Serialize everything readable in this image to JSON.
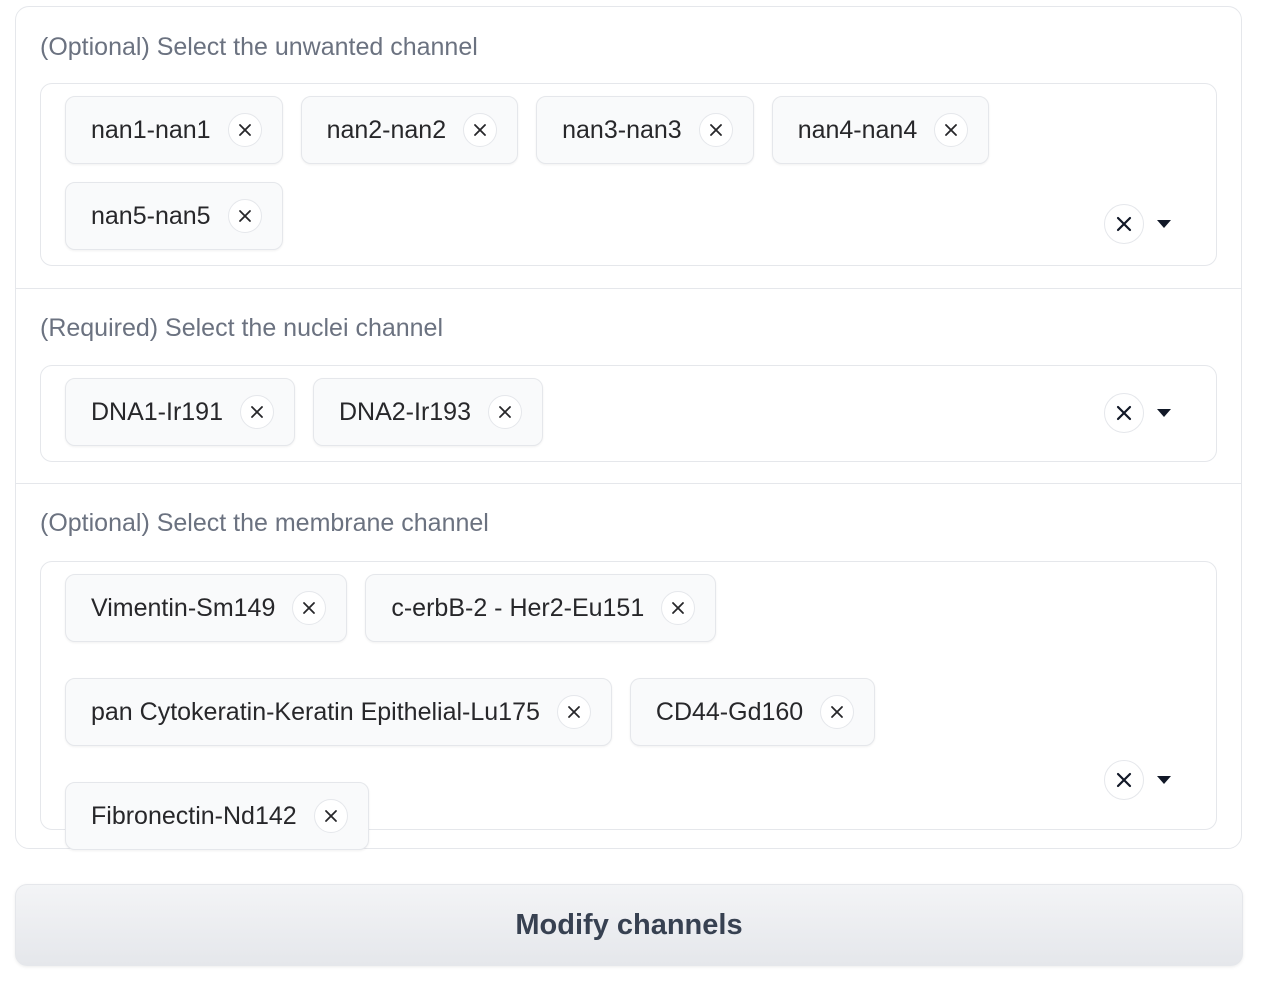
{
  "sections": [
    {
      "label": "(Optional) Select the unwanted channel",
      "chips": [
        "nan1-nan1",
        "nan2-nan2",
        "nan3-nan3",
        "nan4-nan4",
        "nan5-nan5"
      ]
    },
    {
      "label": "(Required) Select the nuclei channel",
      "chips": [
        "DNA1-Ir191",
        "DNA2-Ir193"
      ]
    },
    {
      "label": "(Optional) Select the membrane channel",
      "chips": [
        "Vimentin-Sm149",
        "c-erbB-2 - Her2-Eu151",
        "pan Cytokeratin-Keratin Epithelial-Lu175",
        "CD44-Gd160",
        "Fibronectin-Nd142"
      ]
    }
  ],
  "icons": {
    "chip_remove": "close-icon",
    "clear_all": "close-icon",
    "dropdown": "caret-down-icon"
  },
  "submit": {
    "label": "Modify channels"
  }
}
